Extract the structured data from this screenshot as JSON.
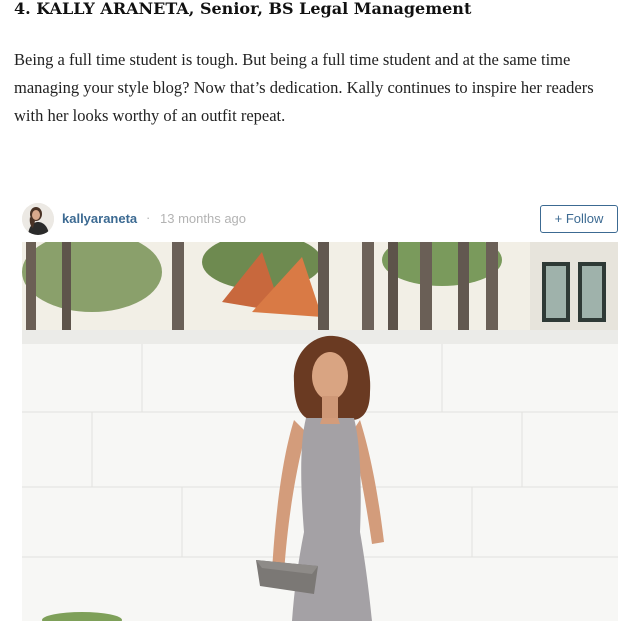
{
  "article": {
    "heading": "4. KALLY ARANETA, Senior, BS Legal Management",
    "paragraph": "Being a full time student is tough. But being a full time student and at the same time managing your style blog? Now that’s dedication. Kally continues to inspire her readers with her looks worthy of an outfit repeat."
  },
  "embed": {
    "username": "kallyaraneta",
    "separator": "·",
    "time_ago": "13 months ago",
    "follow_label": "+ Follow",
    "photo_icon": "outfit-photo",
    "accent_color": "#3c6a92"
  }
}
